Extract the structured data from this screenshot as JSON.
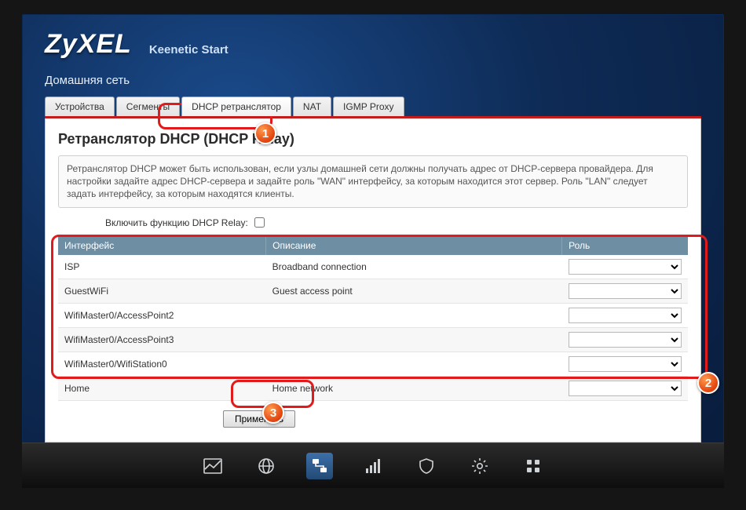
{
  "brand": {
    "logo": "ZyXEL",
    "product": "Keenetic Start"
  },
  "section_title": "Домашняя сеть",
  "tabs": [
    {
      "label": "Устройства",
      "active": false
    },
    {
      "label": "Сегменты",
      "active": false
    },
    {
      "label": "DHCP ретранслятор",
      "active": true
    },
    {
      "label": "NAT",
      "active": false
    },
    {
      "label": "IGMP Proxy",
      "active": false
    }
  ],
  "panel": {
    "heading": "Ретранслятор DHCP (DHCP Relay)",
    "info_text": "Ретранслятор DHCP может быть использован, если узлы домашней сети должны получать адрес от DHCP-сервера провайдера. Для настройки задайте адрес DHCP-сервера и задайте роль \"WAN\" интерфейсу, за которым находится этот сервер. Роль \"LAN\" следует задать интерфейсу, за которым находятся клиенты.",
    "enable_label": "Включить функцию DHCP Relay:",
    "enable_checked": false,
    "columns": {
      "iface": "Интерфейс",
      "desc": "Описание",
      "role": "Роль"
    },
    "rows": [
      {
        "iface": "ISP",
        "desc": "Broadband connection",
        "role": ""
      },
      {
        "iface": "GuestWiFi",
        "desc": "Guest access point",
        "role": ""
      },
      {
        "iface": "WifiMaster0/AccessPoint2",
        "desc": "",
        "role": ""
      },
      {
        "iface": "WifiMaster0/AccessPoint3",
        "desc": "",
        "role": ""
      },
      {
        "iface": "WifiMaster0/WifiStation0",
        "desc": "",
        "role": ""
      },
      {
        "iface": "Home",
        "desc": "Home network",
        "role": ""
      }
    ],
    "apply_label": "Применить"
  },
  "annotations": {
    "step1": "1",
    "step2": "2",
    "step3": "3"
  },
  "dock": {
    "items": [
      {
        "name": "status-icon"
      },
      {
        "name": "globe-icon"
      },
      {
        "name": "network-icon",
        "active": true
      },
      {
        "name": "signal-icon"
      },
      {
        "name": "shield-icon"
      },
      {
        "name": "gear-icon"
      },
      {
        "name": "apps-icon"
      }
    ]
  }
}
